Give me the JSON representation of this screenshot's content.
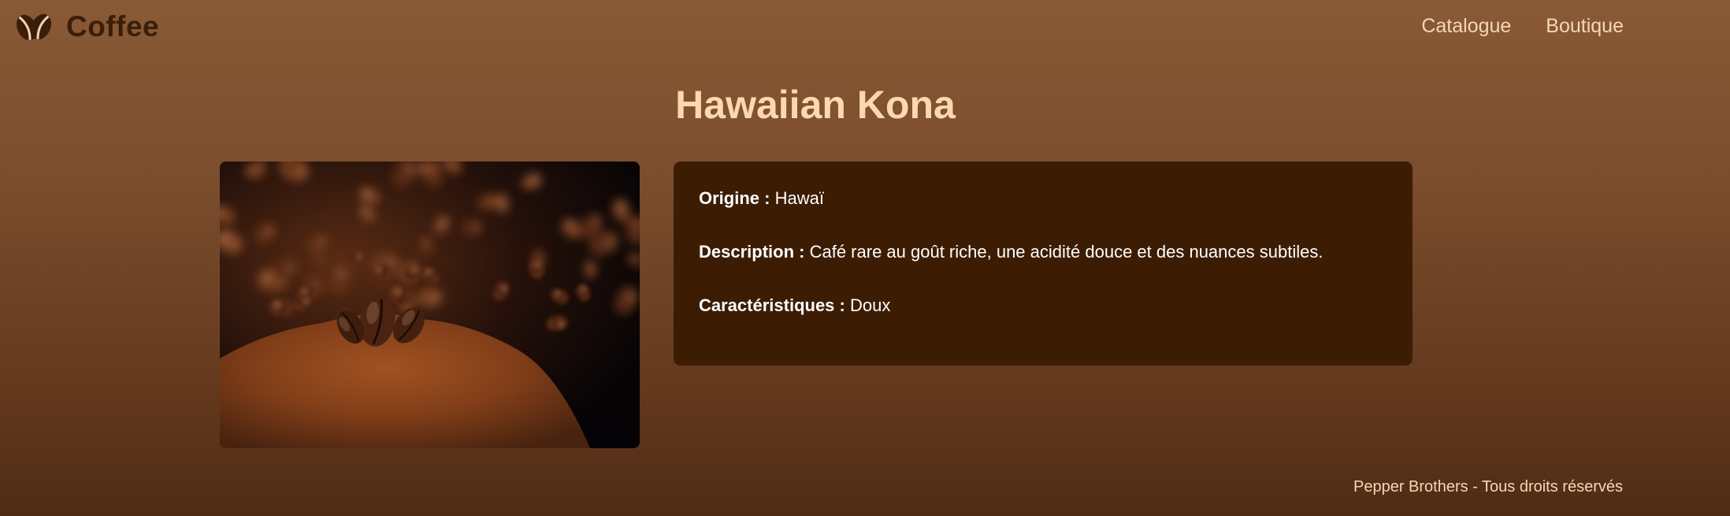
{
  "brand": {
    "name": "Coffee",
    "icon": "coffee-beans-icon"
  },
  "nav": {
    "links": [
      "Catalogue",
      "Boutique"
    ]
  },
  "product": {
    "title": "Hawaiian Kona",
    "image_icon": "coffee-beans-photo",
    "details": [
      {
        "label": "Origine :",
        "value": "Hawaï"
      },
      {
        "label": "Description :",
        "value": "Café rare au goût riche, une acidité douce et des nuances subtiles."
      },
      {
        "label": "Caractéristiques :",
        "value": "Doux"
      }
    ]
  },
  "footer": {
    "text": "Pepper Brothers - Tous droits réservés"
  },
  "colors": {
    "background_top": "#8a5a36",
    "background_bottom": "#4e2c15",
    "brand_text": "#3a1e0a",
    "nav_text": "#f6d6b6",
    "title_text": "#fcd8b0",
    "card_background": "#3c1d04"
  }
}
